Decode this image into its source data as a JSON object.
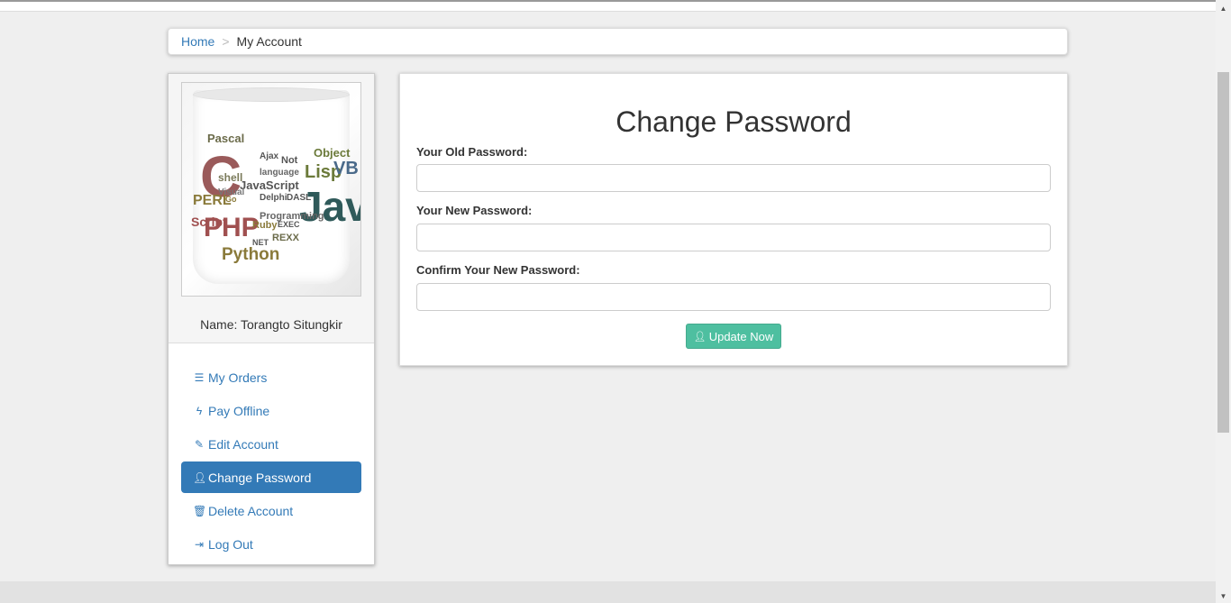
{
  "breadcrumb": {
    "home": "Home",
    "separator": ">",
    "current": "My Account"
  },
  "profile": {
    "name_label": "Name: Torangto Situngkir",
    "avatar_words": [
      "Pascal",
      "C",
      "Ajax",
      "Lisp",
      "VB",
      "Object",
      "shell",
      "language",
      "JavaScript",
      "Java",
      "Visual",
      "Delphi",
      "DASL",
      "PHP",
      "Programming",
      "Ruby",
      "EXEC",
      "Python",
      "NET",
      "REXX",
      "Go",
      "Not",
      "PERL",
      "Script"
    ]
  },
  "menu": {
    "items": [
      {
        "icon": "list-icon",
        "label": "My Orders"
      },
      {
        "icon": "bolt-icon",
        "label": "Pay Offline"
      },
      {
        "icon": "pencil-icon",
        "label": "Edit Account"
      },
      {
        "icon": "user-icon",
        "label": "Change Password",
        "active": true
      },
      {
        "icon": "trash-icon",
        "label": "Delete Account"
      },
      {
        "icon": "sign-out-icon",
        "label": "Log Out"
      }
    ]
  },
  "form": {
    "title": "Change Password",
    "old_password_label": "Your Old Password:",
    "new_password_label": "Your New Password:",
    "confirm_password_label": "Confirm Your New Password:",
    "old_password_value": "",
    "new_password_value": "",
    "confirm_password_value": "",
    "submit_label": "Update Now"
  },
  "colors": {
    "accent": "#337ab7",
    "button": "#4ebfa0",
    "background": "#efefef"
  }
}
